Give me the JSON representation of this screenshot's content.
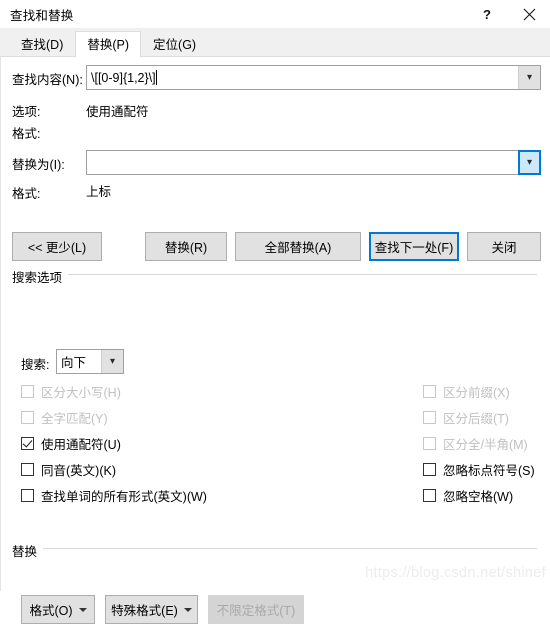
{
  "window": {
    "title": "查找和替换",
    "help_icon": "question-mark-icon",
    "close_icon": "close-icon"
  },
  "tabs": [
    {
      "label": "查找(D)",
      "active": false
    },
    {
      "label": "替换(P)",
      "active": true
    },
    {
      "label": "定位(G)",
      "active": false
    }
  ],
  "find": {
    "label": "查找内容(N):",
    "value": "\\[[0-9]{1,2}\\]",
    "options_label": "选项:",
    "options_value": "使用通配符",
    "format_label": "格式:",
    "format_value": ""
  },
  "replace": {
    "label": "替换为(I):",
    "value": "",
    "format_label": "格式:",
    "format_value": "上标"
  },
  "buttons": {
    "less": "<< 更少(L)",
    "replace": "替换(R)",
    "replace_all": "全部替换(A)",
    "find_next": "查找下一处(F)",
    "close": "关闭"
  },
  "search_options": {
    "group_label": "搜索选项",
    "search_label": "搜索:",
    "search_value": "向下",
    "left_column": [
      {
        "label": "区分大小写(H)",
        "checked": false,
        "disabled": true
      },
      {
        "label": "全字匹配(Y)",
        "checked": false,
        "disabled": true
      },
      {
        "label": "使用通配符(U)",
        "checked": true,
        "disabled": false
      },
      {
        "label": "同音(英文)(K)",
        "checked": false,
        "disabled": false
      },
      {
        "label": "查找单词的所有形式(英文)(W)",
        "checked": false,
        "disabled": false
      }
    ],
    "right_column": [
      {
        "label": "区分前缀(X)",
        "checked": false,
        "disabled": true
      },
      {
        "label": "区分后缀(T)",
        "checked": false,
        "disabled": true
      },
      {
        "label": "区分全/半角(M)",
        "checked": false,
        "disabled": true
      },
      {
        "label": "忽略标点符号(S)",
        "checked": false,
        "disabled": false
      },
      {
        "label": "忽略空格(W)",
        "checked": false,
        "disabled": false
      }
    ]
  },
  "replace_section": {
    "group_label": "替换",
    "format_button": "格式(O)",
    "special_button": "特殊格式(E)",
    "no_format_button": "不限定格式(T)"
  },
  "watermark": "https://blog.csdn.net/shinef",
  "colors": {
    "accent": "#0078d7",
    "button_face": "#e1e1e1",
    "disabled_text": "#c0c0c0"
  }
}
